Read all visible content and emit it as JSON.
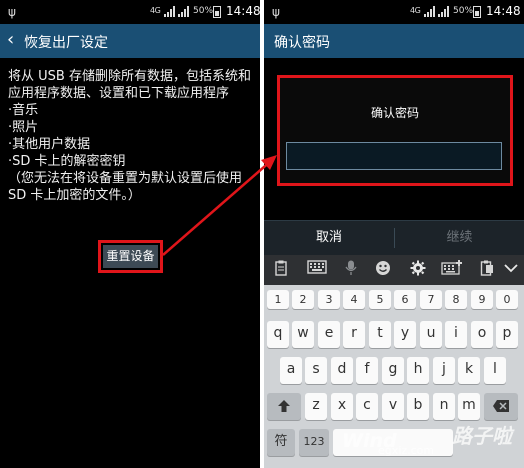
{
  "left": {
    "status": {
      "net": "4G",
      "battery_pct": "50%",
      "time": "14:48"
    },
    "title": "恢复出厂设定",
    "body_lines": [
      "将从 USB 存储删除所有数据，包括系统和应用程序数据、设置和已下载应用程序",
      "·音乐",
      "·照片",
      "·其他用户数据",
      "·SD 卡上的解密密钥",
      "（您无法在将设备重置为默认设置后使用 SD 卡上加密的文件。）"
    ],
    "reset_button": "重置设备"
  },
  "right": {
    "status": {
      "net": "4G",
      "battery_pct": "50%",
      "time": "14:48"
    },
    "title": "确认密码",
    "confirm_label": "确认密码",
    "cancel": "取消",
    "continue": "继续",
    "toolbar_icons": [
      "clipboard-icon",
      "keyboard-icon",
      "mic-icon",
      "emoji-icon",
      "gear-icon",
      "keyboard-grid-icon",
      "clipboard-icon",
      "chevron-down-icon"
    ],
    "keyboard": {
      "num_row": [
        "1",
        "2",
        "3",
        "4",
        "5",
        "6",
        "7",
        "8",
        "9",
        "0"
      ],
      "row1": [
        "q",
        "w",
        "e",
        "r",
        "t",
        "y",
        "u",
        "i",
        "o",
        "p"
      ],
      "row2": [
        "a",
        "s",
        "d",
        "f",
        "g",
        "h",
        "j",
        "k",
        "l"
      ],
      "row3": [
        "z",
        "x",
        "c",
        "v",
        "b",
        "n",
        "m"
      ],
      "bottom_left": "符",
      "bottom_num": "123"
    }
  },
  "watermark": {
    "main": "Wind",
    "tail": "路子啦",
    "sub": "egxiz.com"
  },
  "colors": {
    "header": "#1a4f74",
    "highlight": "#e0151a",
    "keyboard_bg": "#d0d3d6"
  }
}
